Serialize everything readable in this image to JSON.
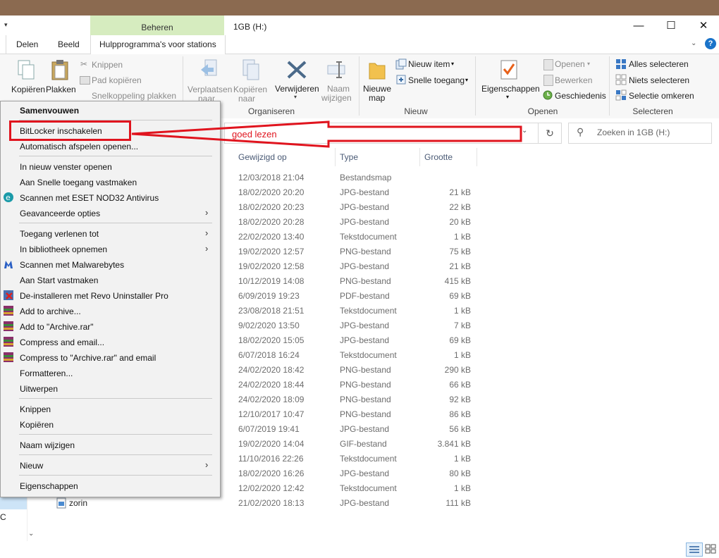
{
  "window": {
    "title": "1GB (H:)",
    "context_tab_group": "Beheren",
    "minimize": "—",
    "maximize": "☐",
    "close": "✕"
  },
  "tabs": [
    "Delen",
    "Beeld",
    "Hulpprogramma's voor stations"
  ],
  "ribbon": {
    "clipboard": {
      "copy": "Kopiëren",
      "paste": "Plakken",
      "cut": "Knippen",
      "copy_path": "Pad kopiëren",
      "paste_shortcut": "Snelkoppeling plakken"
    },
    "organize": {
      "move_to": "Verplaatsen",
      "move_to_2": "naar",
      "copy_to": "Kopiëren",
      "copy_to_2": "naar",
      "delete": "Verwijderen",
      "rename": "Naam",
      "rename_2": "wijzigen",
      "group": "Organiseren"
    },
    "new": {
      "new_folder": "Nieuwe",
      "new_folder_2": "map",
      "new_item": "Nieuw item",
      "easy_access": "Snelle toegang",
      "group": "Nieuw"
    },
    "open": {
      "properties": "Eigenschappen",
      "open": "Openen",
      "edit": "Bewerken",
      "history": "Geschiedenis",
      "group": "Openen"
    },
    "select": {
      "select_all": "Alles selecteren",
      "select_none": "Niets selecteren",
      "invert": "Selectie omkeren",
      "group": "Selecteren"
    }
  },
  "search": {
    "placeholder": "Zoeken in 1GB (H:)"
  },
  "columns": [
    "Gewijzigd op",
    "Type",
    "Grootte"
  ],
  "rows": [
    {
      "date": "12/03/2018 21:04",
      "type": "Bestandsmap",
      "size": ""
    },
    {
      "date": "18/02/2020 20:20",
      "type": "JPG-bestand",
      "size": "21 kB"
    },
    {
      "date": "18/02/2020 20:23",
      "type": "JPG-bestand",
      "size": "22 kB"
    },
    {
      "date": "18/02/2020 20:28",
      "type": "JPG-bestand",
      "size": "20 kB"
    },
    {
      "date": "22/02/2020 13:40",
      "type": "Tekstdocument",
      "size": "1 kB"
    },
    {
      "date": "19/02/2020 12:57",
      "type": "PNG-bestand",
      "size": "75 kB"
    },
    {
      "date": "19/02/2020 12:58",
      "type": "JPG-bestand",
      "size": "21 kB"
    },
    {
      "date": "10/12/2019 14:08",
      "type": "PNG-bestand",
      "size": "415 kB"
    },
    {
      "date": "6/09/2019 19:23",
      "type": "PDF-bestand",
      "size": "69 kB"
    },
    {
      "date": "23/08/2018 21:51",
      "type": "Tekstdocument",
      "size": "1 kB"
    },
    {
      "date": "9/02/2020 13:50",
      "type": "JPG-bestand",
      "size": "7 kB"
    },
    {
      "date": "18/02/2020 15:05",
      "type": "JPG-bestand",
      "size": "69 kB"
    },
    {
      "date": "6/07/2018 16:24",
      "type": "Tekstdocument",
      "size": "1 kB"
    },
    {
      "date": "24/02/2020 18:42",
      "type": "PNG-bestand",
      "size": "290 kB"
    },
    {
      "date": "24/02/2020 18:44",
      "type": "PNG-bestand",
      "size": "66 kB"
    },
    {
      "date": "24/02/2020 18:09",
      "type": "PNG-bestand",
      "size": "92 kB"
    },
    {
      "date": "12/10/2017 10:47",
      "type": "PNG-bestand",
      "size": "86 kB"
    },
    {
      "date": "6/07/2019 19:41",
      "type": "JPG-bestand",
      "size": "56 kB"
    },
    {
      "date": "19/02/2020 14:04",
      "type": "GIF-bestand",
      "size": "3.841 kB"
    },
    {
      "date": "11/10/2016 22:26",
      "type": "Tekstdocument",
      "size": "1 kB"
    },
    {
      "date": "18/02/2020 16:26",
      "type": "JPG-bestand",
      "size": "80 kB"
    },
    {
      "date": "12/02/2020 12:42",
      "type": "Tekstdocument",
      "size": "1 kB"
    },
    {
      "date": "21/02/2020 18:13",
      "type": "JPG-bestand",
      "size": "111 kB"
    }
  ],
  "last_row_name": "zorin",
  "nav_partial": "C",
  "context_menu": {
    "collapse": "Samenvouwen",
    "bitlocker": "BitLocker inschakelen",
    "autoplay": "Automatisch afspelen openen...",
    "new_window": "In nieuw venster openen",
    "pin_quick": "Aan Snelle toegang vastmaken",
    "eset": "Scannen met ESET NOD32 Antivirus",
    "advanced": "Geavanceerde opties",
    "give_access": "Toegang verlenen tot",
    "library": "In bibliotheek opnemen",
    "malwarebytes": "Scannen met Malwarebytes",
    "pin_start": "Aan Start vastmaken",
    "revo": "De-installeren met Revo Uninstaller Pro",
    "add_archive": "Add to archive...",
    "add_rar": "Add to \"Archive.rar\"",
    "compress_email": "Compress and email...",
    "compress_rar_email": "Compress to \"Archive.rar\" and email",
    "format": "Formatteren...",
    "eject": "Uitwerpen",
    "cut": "Knippen",
    "copy": "Kopiëren",
    "rename": "Naam wijzigen",
    "new": "Nieuw",
    "properties": "Eigenschappen"
  },
  "annotation": {
    "text": "goed lezen",
    "color": "#e0141e"
  }
}
